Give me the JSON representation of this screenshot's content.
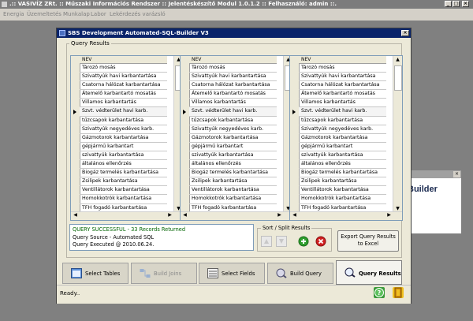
{
  "app": {
    "title": ".:: VASIVÍZ ZRt. :: Műszaki Információs Rendszer  ::  Jelentéskészítő Modul 1.0.1.2 :: Felhasználó: admin ::.",
    "menu": [
      "Energia",
      "Üzemeltetés",
      "Munkalap",
      "Labor",
      "Lekérdezés varázsló"
    ]
  },
  "background_window": {
    "title_fragment": "Builder"
  },
  "dialog": {
    "title": "SBS Development Automated-SQL-Builder V3",
    "group_label": "Query Results",
    "grids": [
      {
        "column_header": "NEV"
      },
      {
        "column_header": "NEV"
      },
      {
        "column_header": "NEV"
      }
    ],
    "rows": [
      "Tározó mosás",
      "Szivattyúk havi karbantartása",
      "Csatorna hálózat karbantartása",
      "Átemelő karbantartó mosatás",
      "Villamos karbantartás",
      "Szvt. védterület havi karb.",
      "tűzcsapok karbantartása",
      "Szivattyúk negyedéves karb.",
      "Gázmotorok karbantartása",
      "gépjármű karbantart",
      "szivattyúk karbantartása",
      "általános ellenőrzés",
      "Biogáz termelés karbantartása",
      "Zsilipek karbantartása",
      "Ventillátorok karbantartása",
      "Homokkotrók karbantartása",
      "TFH fogadó karbantartása"
    ],
    "current_row_index": 5,
    "status_lines": [
      "QUERY SUCCESSFUL  - 33 Records Returned",
      "Query Source - Automated SQL",
      "Query Executed @ 2010.06.24."
    ],
    "sort_label": "Sort / Split Results",
    "export_label": "Export Query Results to Excel",
    "tabs": [
      {
        "label": "Select Tables",
        "active": false,
        "enabled": true
      },
      {
        "label": "Build Joins",
        "active": false,
        "enabled": false
      },
      {
        "label": "Select Fields",
        "active": false,
        "enabled": true
      },
      {
        "label": "Build Query",
        "active": false,
        "enabled": true
      },
      {
        "label": "Query Results",
        "active": true,
        "enabled": true
      }
    ],
    "status_bar": "Ready.."
  },
  "colors": {
    "dialog_title_bg": "#0a246a",
    "success_text": "#006400",
    "add_button": "#2e9e2e",
    "remove_button": "#d02020"
  }
}
